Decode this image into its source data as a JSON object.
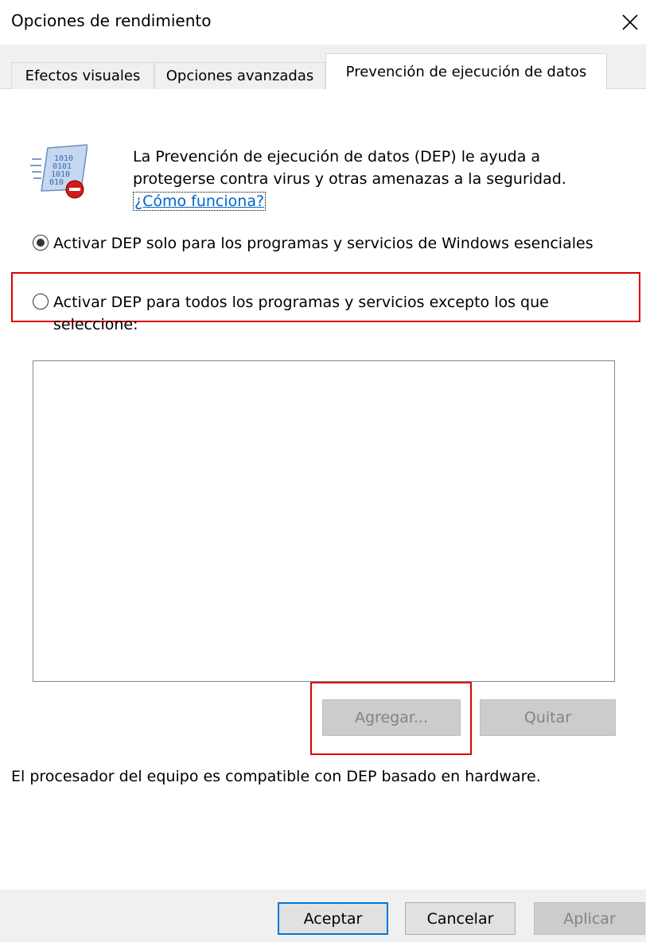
{
  "window": {
    "title": "Opciones de rendimiento"
  },
  "tabs": [
    {
      "label": "Efectos visuales"
    },
    {
      "label": "Opciones avanzadas"
    },
    {
      "label": "Prevención de ejecución de datos"
    }
  ],
  "dep": {
    "description": "La Prevención de ejecución de datos (DEP) le ayuda a protegerse contra virus y otras amenazas a la seguridad.",
    "link": "¿Cómo funciona?",
    "option1": "Activar DEP solo para los programas y servicios de Windows esenciales",
    "option2": "Activar DEP para todos los programas y servicios excepto los que seleccione:",
    "selected_option": 1,
    "add_label": "Agregar...",
    "remove_label": "Quitar",
    "processor_text": "El procesador del equipo es compatible con DEP basado en hardware."
  },
  "footer": {
    "ok": "Aceptar",
    "cancel": "Cancelar",
    "apply": "Aplicar"
  },
  "colors": {
    "highlight": "#e00000",
    "link": "#0066cc",
    "default_button_border": "#0078d7"
  },
  "icons": {
    "close": "close-icon",
    "dep": "dep-shield-icon"
  }
}
